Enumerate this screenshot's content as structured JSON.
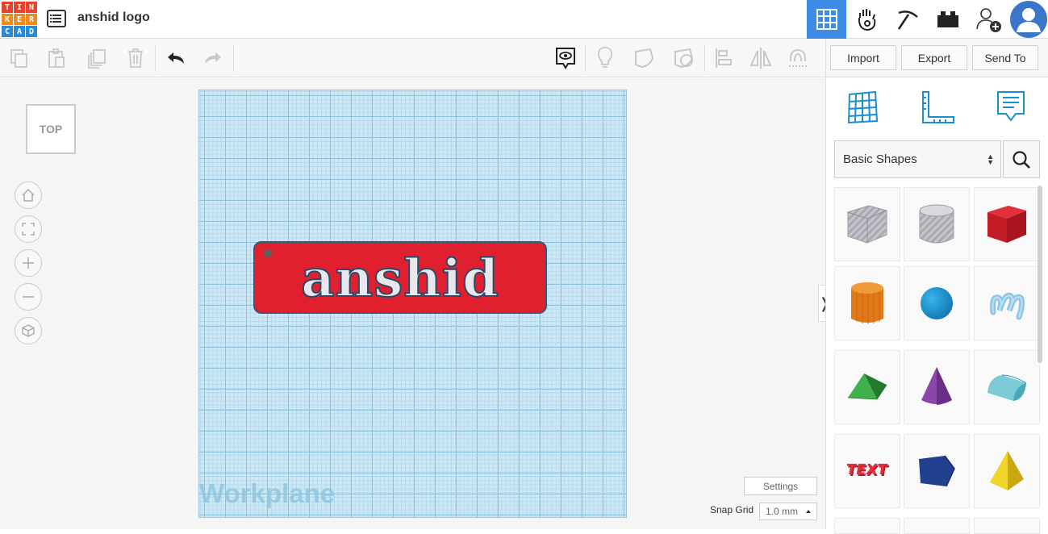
{
  "app": {
    "logo_letters": [
      "T",
      "I",
      "N",
      "K",
      "E",
      "R",
      "C",
      "A",
      "D"
    ],
    "logo_colors": [
      "#e8412c",
      "#e8412c",
      "#e8412c",
      "#f08a1c",
      "#f08a1c",
      "#f08a1c",
      "#2a8ad4",
      "#2a8ad4",
      "#2a8ad4"
    ],
    "project_title": "anshid logo"
  },
  "topnav": {
    "items": [
      {
        "name": "3d-design-view",
        "icon": "grid-icon",
        "active": true
      },
      {
        "name": "blocks-view",
        "icon": "hand-icon",
        "active": false
      },
      {
        "name": "bricks-view",
        "icon": "pickaxe-icon",
        "active": false
      },
      {
        "name": "lego-view",
        "icon": "brick-icon",
        "active": false
      },
      {
        "name": "invite-user",
        "icon": "add-user-icon",
        "active": false
      },
      {
        "name": "profile",
        "icon": "avatar-icon",
        "active": false
      }
    ]
  },
  "toolbar": {
    "copy": "copy-icon",
    "paste": "paste-icon",
    "duplicate": "duplicate-icon",
    "delete": "trash-icon",
    "undo": "undo-icon",
    "redo": "redo-icon",
    "notes": "notes-icon",
    "light": "bulb-icon",
    "solid": "solid-icon",
    "hole": "hole-icon",
    "align": "align-icon",
    "mirror": "mirror-icon",
    "magnet": "magnet-icon",
    "import_label": "Import",
    "export_label": "Export",
    "sendto_label": "Send To"
  },
  "viewport": {
    "view_cube_label": "TOP",
    "nav_controls": [
      "home-icon",
      "fit-icon",
      "zoom-in-icon",
      "zoom-out-icon",
      "perspective-icon"
    ],
    "workplane_label": "Workplane",
    "design_text": "anshid",
    "tag_color": "#e0202e",
    "settings_label": "Settings",
    "snap_grid_label": "Snap Grid",
    "snap_grid_value": "1.0 mm"
  },
  "panel": {
    "tool_icons": [
      "workplane-icon",
      "ruler-icon",
      "notes-panel-icon"
    ],
    "category": "Basic Shapes",
    "shapes": [
      {
        "name": "box-hole",
        "color": "#b9b9c0"
      },
      {
        "name": "cylinder-hole",
        "color": "#c9c9cf"
      },
      {
        "name": "box",
        "color": "#d51f2b"
      },
      {
        "name": "cylinder",
        "color": "#e87a17"
      },
      {
        "name": "sphere",
        "color": "#1a96d2"
      },
      {
        "name": "scribble",
        "color": "#7fb9dd"
      },
      {
        "name": "roof",
        "color": "#2f9a3a"
      },
      {
        "name": "cone",
        "color": "#7c3a9a"
      },
      {
        "name": "round-roof",
        "color": "#5ab9c9"
      },
      {
        "name": "text",
        "color": "#c52030"
      },
      {
        "name": "polygon",
        "color": "#223e8c"
      },
      {
        "name": "pyramid",
        "color": "#e0c21c"
      }
    ]
  }
}
